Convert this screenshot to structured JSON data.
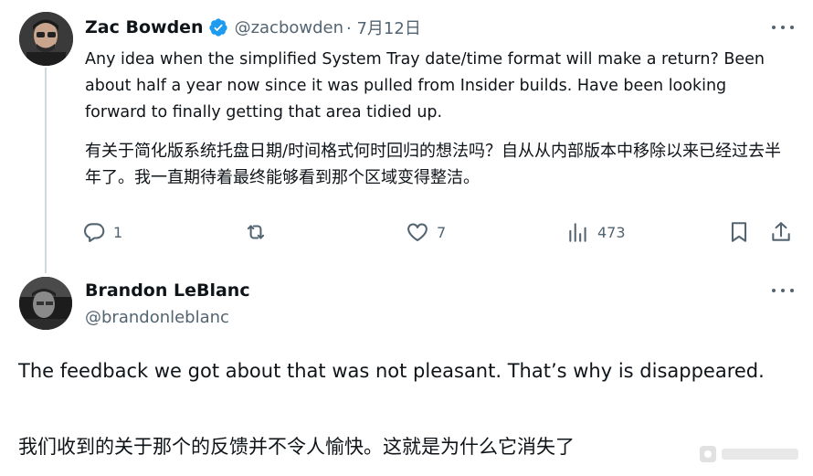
{
  "tweet1": {
    "author_name": "Zac Bowden",
    "handle": "@zacbowden",
    "time": "· 7月12日",
    "text": "Any idea when the simplified System Tray date/time format will make a return? Been about half a year now since it was pulled from Insider builds. Have been looking forward to finally getting that area tidied up.",
    "translation": "有关于简化版系统托盘日期/时间格式何时回归的想法吗？自从从内部版本中移除以来已经过去半年了。我一直期待着最终能够看到那个区域变得整洁。",
    "actions": {
      "replies": "1",
      "reposts": "",
      "likes": "7",
      "views": "473"
    }
  },
  "tweet2": {
    "author_name": "Brandon LeBlanc",
    "handle": "@brandonleblanc",
    "text": "The feedback we got about that was not pleasant. That’s why is disappeared.",
    "translation": "我们收到的关于那个的反馈并不令人愉快。这就是为什么它消失了"
  },
  "colors": {
    "text": "#0f1419",
    "secondary": "#536471",
    "verified": "#1d9bf0",
    "thread_line": "#cfd9de"
  },
  "icons": {
    "verified": "verified-badge-icon",
    "more": "more-options-icon",
    "reply": "reply-icon",
    "repost": "repost-icon",
    "like": "heart-icon",
    "views": "views-chart-icon",
    "bookmark": "bookmark-icon",
    "share": "share-icon"
  }
}
